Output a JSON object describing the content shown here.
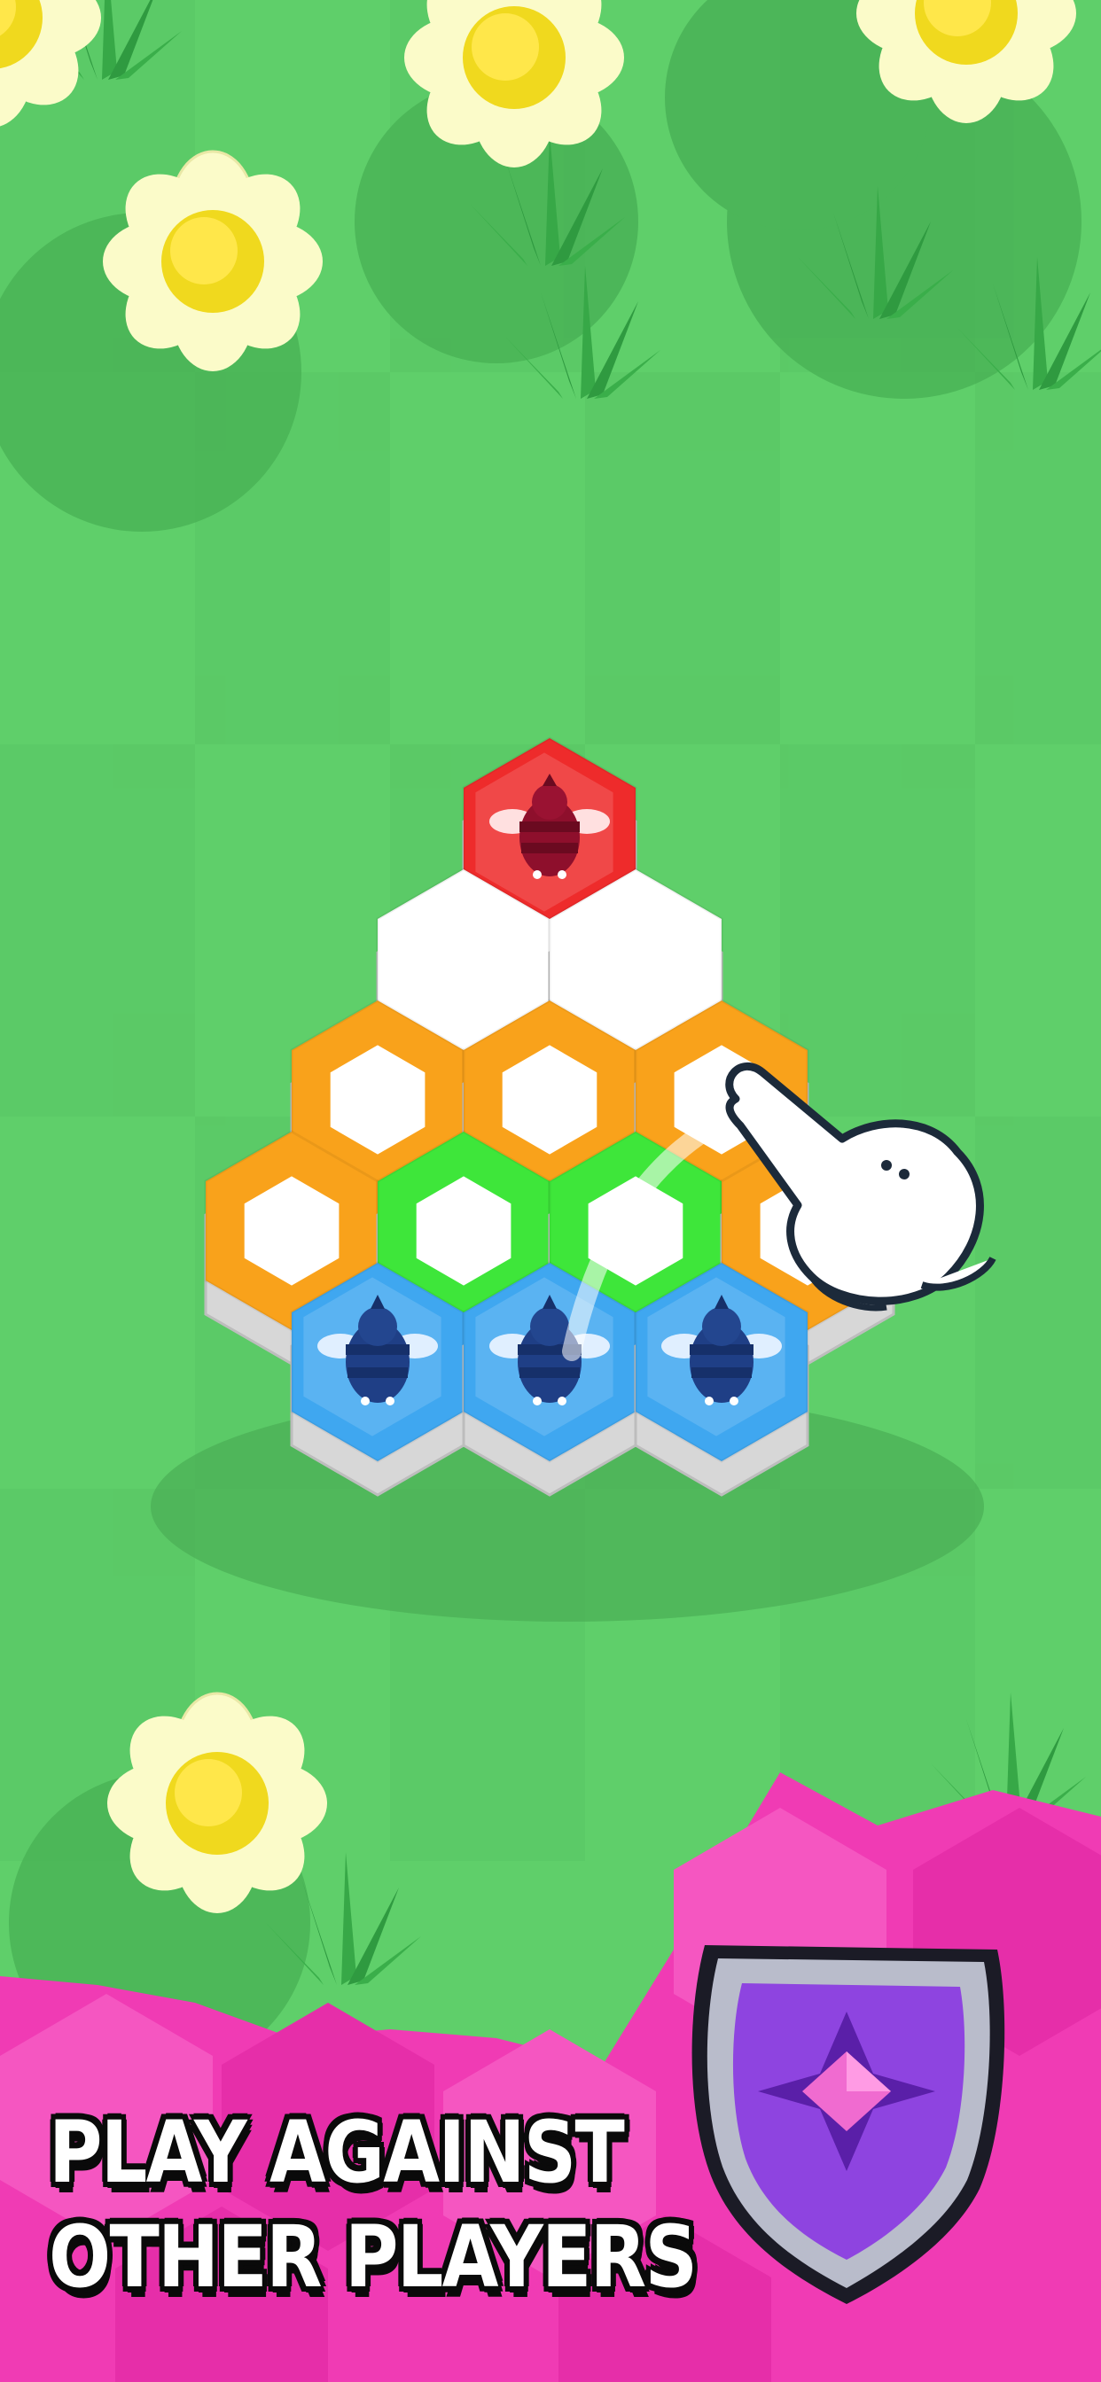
{
  "promo": {
    "line1": "PLAY AGAINST",
    "line2": "OTHER PLAYERS"
  },
  "colors": {
    "grass": "#5fcf6a",
    "grass_dark": "#4fb85a",
    "red_player": "#ee2b2b",
    "blue_player": "#3fa7f0",
    "orange_tile": "#f9a21b",
    "green_tile": "#3ee63a",
    "empty_tile": "#ffffff",
    "banner_pink": "#f03bb4",
    "shield_purple": "#8e44e0"
  },
  "board": {
    "rows": [
      [
        "red"
      ],
      [
        "white",
        "white"
      ],
      [
        "orange",
        "orange",
        "orange"
      ],
      [
        "orange",
        "green",
        "green",
        "orange"
      ],
      [
        "blue",
        "blue",
        "blue"
      ]
    ]
  },
  "icons": [
    "flower-icon",
    "bee-icon",
    "pointing-hand-icon",
    "shield-gem-icon"
  ]
}
